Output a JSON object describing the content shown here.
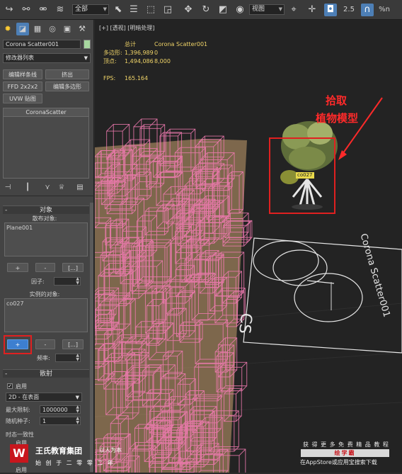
{
  "toolbar": {
    "selection_filter": "全部",
    "view_mode": "视图",
    "snap_value": "2.5",
    "percent_snap": "%n",
    "icons": [
      "redo-icon",
      "link-icon",
      "unlink-icon",
      "bind-space-warp-icon",
      "select-icon",
      "select-by-name-icon",
      "rect-region-icon",
      "window-crossing-icon",
      "move-icon",
      "rotate-icon",
      "scale-icon",
      "reference-coord-icon",
      "pivot-icon",
      "snap-icon",
      "angle-snap-icon",
      "percent-snap-icon"
    ]
  },
  "command_panel": {
    "tabs": [
      "create-icon",
      "modify-icon",
      "hierarchy-icon",
      "motion-icon",
      "display-icon",
      "utilities-icon"
    ],
    "object_name": "Corona Scatter001",
    "object_color": "#a8d8a0",
    "modifier_list": "修改器列表",
    "modifier_buttons": [
      "编辑样条线",
      "挤出",
      "FFD 2x2x2",
      "编辑多边形",
      "UVW 贴图"
    ],
    "stack_item": "CoronaScatter",
    "objects_section": {
      "title": "对象",
      "distribute_label": "散布对象:",
      "distribute_item": "Plane001",
      "add": "+",
      "remove": "-",
      "more": "[...]",
      "factor_label": "因子:",
      "instance_label": "实例的对象:",
      "instance_item": "co027",
      "frequency_label": "频率:"
    },
    "distribution_section": {
      "title": "散射",
      "enable_label": "启用",
      "mode": "2D - 在表面",
      "max_limit_label": "最大限制:",
      "max_limit_value": "1000000",
      "seed_label": "随机种子:",
      "seed_value": "1",
      "consistency_label": "时态一致性",
      "enable2": "启用"
    }
  },
  "viewport": {
    "label": "[+] [透视] [明暗处理]",
    "stats": {
      "total_label": "总计",
      "object_name": "Corona Scatter001",
      "poly_label": "多边形:",
      "poly_total": "1,396,989",
      "poly_sel": "0",
      "vert_label": "顶点:",
      "vert_total": "1,494,086",
      "vert_sel": "8,000",
      "fps_label": "FPS:",
      "fps_value": "165.164"
    },
    "annotation_line1": "拾取",
    "annotation_line2": "植物模型",
    "instance_tag": "co027",
    "spline_label": "Corona Scatter001",
    "cs_label": "CS",
    "colors": {
      "wire": "#f07ab0",
      "surface": "#c8a070",
      "annotation": "#ff2a2a"
    }
  },
  "watermark": {
    "logo_char": "W",
    "group_name": "王氏教育集团",
    "slogan": "以人为本",
    "sub": "始 创 于 二 零 零 二 年",
    "promo_line1": "获 得 更 多 免 费 精 品 教 程",
    "promo_bar": "绘学霸",
    "promo_line2": "在AppStore或应用宝搜索下载"
  }
}
